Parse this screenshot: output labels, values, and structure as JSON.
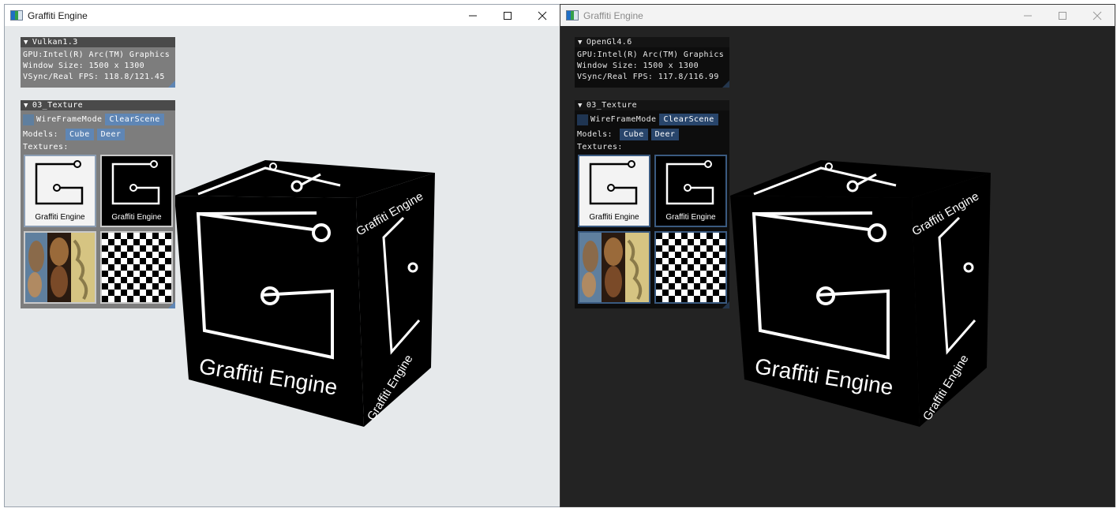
{
  "windows": [
    {
      "title": "Graffiti Engine",
      "theme": "light",
      "info_panel": {
        "header": "Vulkan1.3",
        "gpu": "GPU:Intel(R) Arc(TM) Graphics",
        "window_size": "Window Size: 1500 x 1300",
        "fps": "VSync/Real FPS: 118.8/121.45"
      },
      "texture_panel": {
        "header": "03_Texture",
        "wireframe_label": "WireFrameMode",
        "clear_scene_label": "ClearScene",
        "models_label": "Models:",
        "models": [
          "Cube",
          "Deer"
        ],
        "textures_label": "Textures:",
        "texture_captions": [
          "Graffiti Engine",
          "Graffiti Engine"
        ]
      },
      "cube_text": "Graffiti Engine"
    },
    {
      "title": "Graffiti Engine",
      "theme": "dark",
      "info_panel": {
        "header": "OpenGl4.6",
        "gpu": "GPU:Intel(R) Arc(TM) Graphics",
        "window_size": "Window Size: 1500 x 1300",
        "fps": "VSync/Real FPS: 117.8/116.99"
      },
      "texture_panel": {
        "header": "03_Texture",
        "wireframe_label": "WireFrameMode",
        "clear_scene_label": "ClearScene",
        "models_label": "Models:",
        "models": [
          "Cube",
          "Deer"
        ],
        "textures_label": "Textures:",
        "texture_captions": [
          "Graffiti Engine",
          "Graffiti Engine"
        ]
      },
      "cube_text": "Graffiti Engine"
    }
  ],
  "icons": {
    "minimize": "minimize-icon",
    "maximize": "maximize-icon",
    "close": "close-icon",
    "collapse": "triangle-down-icon"
  },
  "colors": {
    "light_bg": "#e6e9eb",
    "dark_bg": "#232323",
    "accent_light": "#5f86b5",
    "accent_dark": "#28456b"
  }
}
